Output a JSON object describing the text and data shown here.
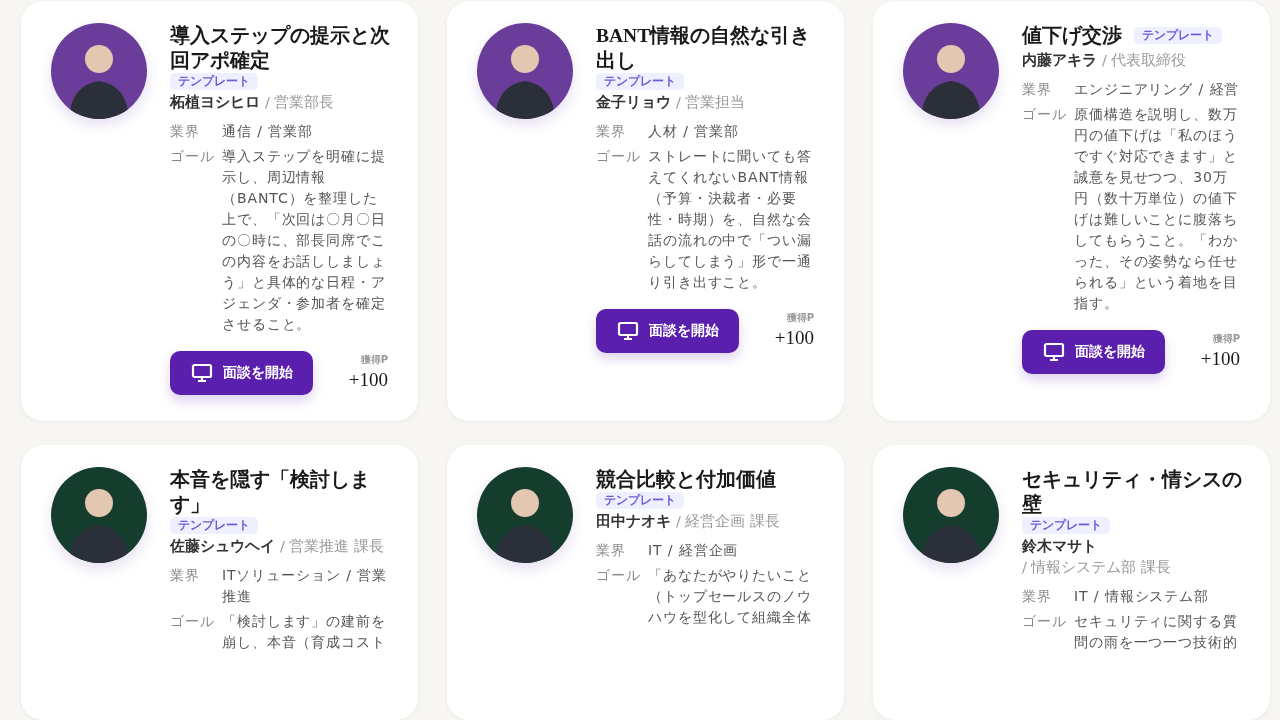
{
  "cards": [
    {
      "title": "導入ステップの提示と次回アポ確定",
      "badge": "テンプレート",
      "color": "#6a3d9a",
      "name": "柘植ヨシヒロ",
      "role": "/ 営業部長",
      "fields": [
        {
          "label": "業界",
          "value": "通信 / 営業部"
        },
        {
          "label": "ゴール",
          "value": "導入ステップを明確に提示し、周辺情報（BANTC）を整理した上で、「次回は〇月〇日の〇時に、部長同席でこの内容をお話ししましょう」と具体的な日程・アジェンダ・参加者を確定させること。"
        }
      ],
      "button": "面談を開始",
      "points_label": "獲得P",
      "points": "+100"
    },
    {
      "title": "BANT情報の自然な引き出し",
      "badge": "テンプレート",
      "color": "#6a3d9a",
      "name": "金子リョウ",
      "role": "/ 営業担当",
      "fields": [
        {
          "label": "業界",
          "value": "人材 / 営業部"
        },
        {
          "label": "ゴール",
          "value": "ストレートに聞いても答えてくれないBANT情報（予算・決裁者・必要性・時期）を、自然な会話の流れの中で「つい漏らしてしまう」形で一通り引き出すこと。"
        }
      ],
      "button": "面談を開始",
      "points_label": "獲得P",
      "points": "+100"
    },
    {
      "title": "値下げ交渉",
      "badge": "テンプレート",
      "color": "#6a3d9a",
      "name": "内藤アキラ",
      "role": "/ 代表取締役",
      "fields": [
        {
          "label": "業界",
          "value": "エンジニアリング / 経営"
        },
        {
          "label": "ゴール",
          "value": "原価構造を説明し、数万円の値下げは「私のほうですぐ対応できます」と誠意を見せつつ、30万円（数十万単位）の値下げは難しいことに腹落ちしてもらうこと。「わかった、その姿勢なら任せられる」という着地を目指す。"
        }
      ],
      "button": "面談を開始",
      "points_label": "獲得P",
      "points": "+100"
    },
    {
      "title": "本音を隠す「検討します」",
      "badge": "テンプレート",
      "color": "#143d2e",
      "name": "佐藤シュウヘイ",
      "role": "/ 営業推進 課長",
      "fields": [
        {
          "label": "業界",
          "value": "ITソリューション / 営業推進"
        },
        {
          "label": "ゴール",
          "value": "「検討します」の建前を崩し、本音（育成コスト"
        }
      ]
    },
    {
      "title": "競合比較と付加価値",
      "badge": "テンプレート",
      "color": "#143d2e",
      "name": "田中ナオキ",
      "role": "/ 経営企画 課長",
      "fields": [
        {
          "label": "業界",
          "value": "IT / 経営企画"
        },
        {
          "label": "ゴール",
          "value": "「あなたがやりたいこと（トップセールスのノウハウを型化して組織全体"
        }
      ]
    },
    {
      "title": "セキュリティ・情シスの壁",
      "badge": "テンプレート",
      "color": "#143d2e",
      "name": "鈴木マサト",
      "role": "/ 情報システム部 課長",
      "fields": [
        {
          "label": "業界",
          "value": "IT / 情報システム部"
        },
        {
          "label": "ゴール",
          "value": "セキュリティに関する質問の雨を一つ一つ技術的"
        }
      ]
    }
  ]
}
